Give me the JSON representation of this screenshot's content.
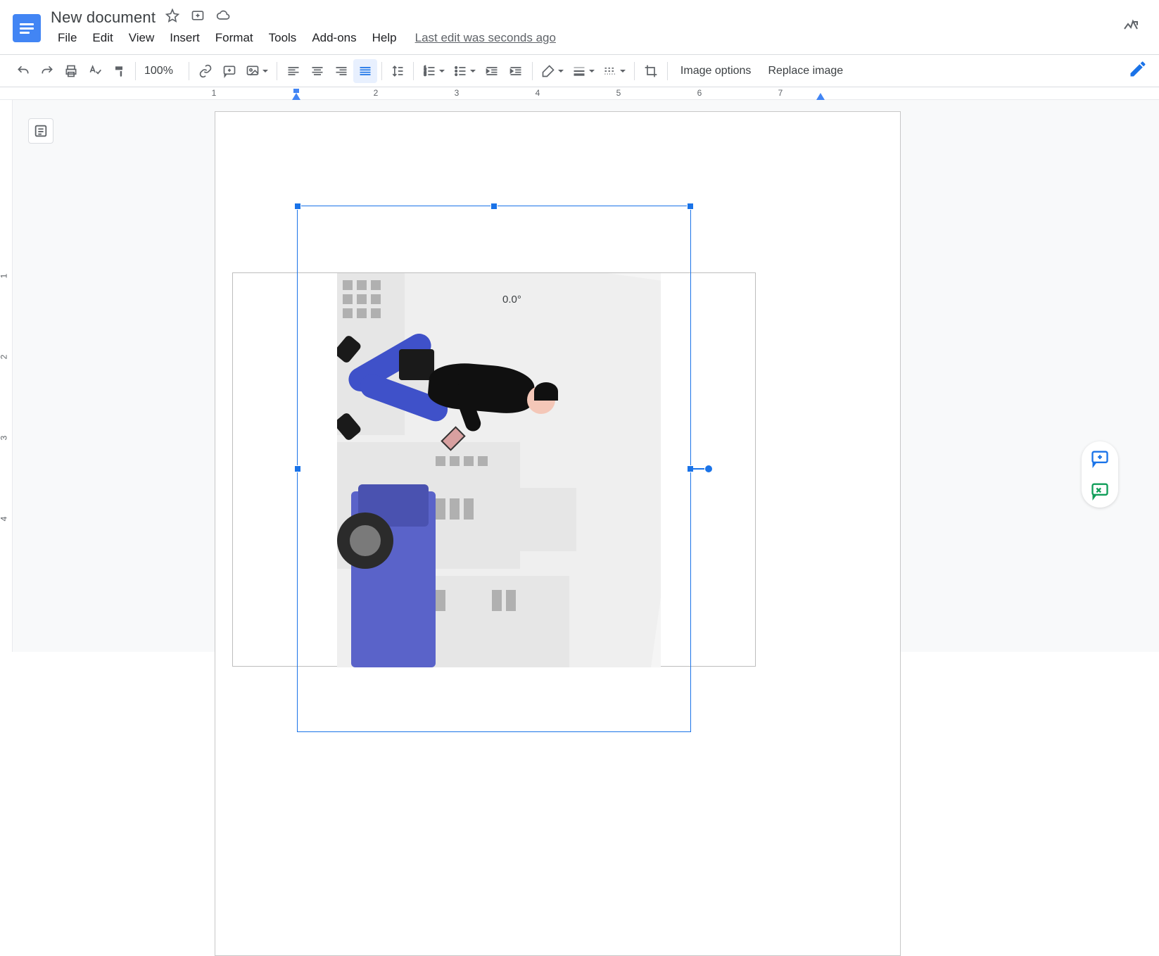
{
  "header": {
    "title": "New document",
    "last_edit": "Last edit was seconds ago"
  },
  "menu": {
    "file": "File",
    "edit": "Edit",
    "view": "View",
    "insert": "Insert",
    "format": "Format",
    "tools": "Tools",
    "addons": "Add-ons",
    "help": "Help"
  },
  "toolbar": {
    "zoom": "100%",
    "image_options": "Image options",
    "replace_image": "Replace image"
  },
  "ruler": {
    "horizontal": [
      "1",
      "2",
      "3",
      "4",
      "5",
      "6",
      "7"
    ],
    "vertical": [
      "1",
      "2",
      "3",
      "4"
    ]
  },
  "canvas": {
    "rotation_label": "0.0°"
  }
}
